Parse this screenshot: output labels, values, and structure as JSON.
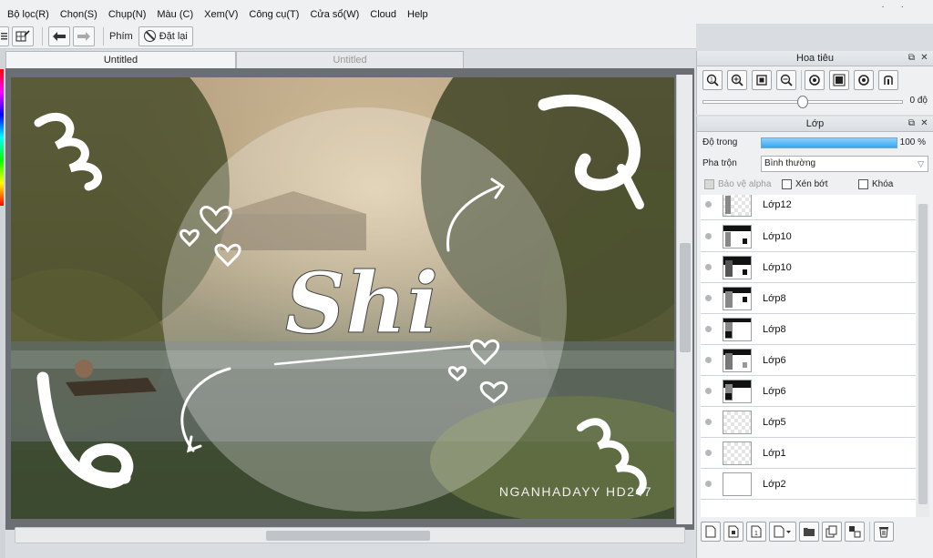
{
  "menu": {
    "items": [
      "Bộ lọc(R)",
      "Chọn(S)",
      "Chụp(N)",
      "Màu (C)",
      "Xem(V)",
      "Công cụ(T)",
      "Cửa sổ(W)",
      "Cloud",
      "Help"
    ]
  },
  "toolbar": {
    "shortcut_label": "Phím",
    "reset_label": "Đặt lại"
  },
  "tabs": [
    "Untitled",
    "Untitled"
  ],
  "artwork": {
    "title_text": "Shi",
    "watermark": "NGANHADAYY HD247"
  },
  "navigator": {
    "title": "Hoa tiêu",
    "angle": "0 độ",
    "zoom_value": 0.5
  },
  "layers": {
    "title": "Lớp",
    "opacity_label": "Độ trong",
    "opacity_value": "100 %",
    "blend_label": "Pha trộn",
    "blend_value": "Bình thường",
    "protect_alpha": "Bảo vệ alpha",
    "clip": "Xén bớt",
    "lock": "Khóa",
    "items": [
      {
        "name": "Lớp12"
      },
      {
        "name": "Lớp10"
      },
      {
        "name": "Lớp10"
      },
      {
        "name": "Lớp8"
      },
      {
        "name": "Lớp8"
      },
      {
        "name": "Lớp6"
      },
      {
        "name": "Lớp6"
      },
      {
        "name": "Lớp5"
      },
      {
        "name": "Lớp1"
      },
      {
        "name": "Lớp2"
      }
    ]
  },
  "colors": {
    "accent": "#37a6f0",
    "panel_bg": "#eef0f2",
    "canvas_bg": "#6b6f73"
  }
}
